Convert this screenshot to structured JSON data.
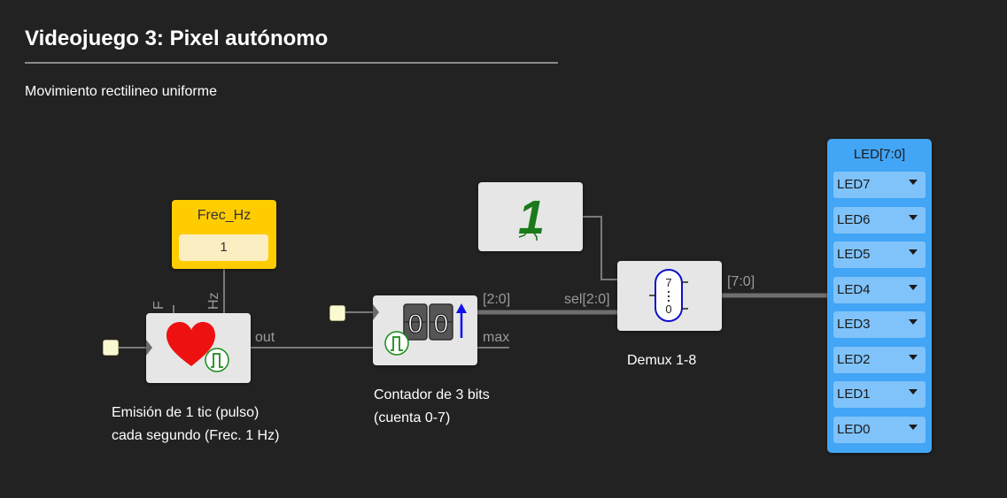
{
  "page": {
    "title": "Videojuego 3: Pixel autónomo",
    "subtitle": "Movimiento rectilineo uniforme"
  },
  "frequency_block": {
    "label": "Frec_Hz",
    "value": "1"
  },
  "pulse_block": {
    "port_f": "F",
    "port_hz": "Hz",
    "port_out": "out",
    "caption_line1": "Emisión de 1 tic (pulso)",
    "caption_line2": "cada segundo (Frec. 1 Hz)",
    "icon": "heart-pulse-icon"
  },
  "counter_block": {
    "digits": [
      "0",
      "0"
    ],
    "port_bus": "[2:0]",
    "port_max": "max",
    "caption_line1": "Contador de 3 bits",
    "caption_line2": "(cuenta 0-7)",
    "icon": "counter-up-icon"
  },
  "constant_block": {
    "value": "1",
    "icon": "walking-one-icon"
  },
  "demux_block": {
    "port_sel": "sel[2:0]",
    "port_bus": "[7:0]",
    "top_value": "7",
    "bottom_value": "0",
    "caption": "Demux 1-8"
  },
  "led_panel": {
    "title": "LED[7:0]",
    "leds": [
      "LED7",
      "LED6",
      "LED5",
      "LED4",
      "LED3",
      "LED2",
      "LED1",
      "LED0"
    ]
  },
  "colors": {
    "background": "#222222",
    "wire": "#7a7a7a",
    "bus": "#6f6f6f",
    "frequency_block": "#ffcc00",
    "led_panel": "#42a5f5",
    "heart": "#ee1111",
    "pulse_icon": "#1a8a1a",
    "demux_outline": "#1010cc"
  }
}
